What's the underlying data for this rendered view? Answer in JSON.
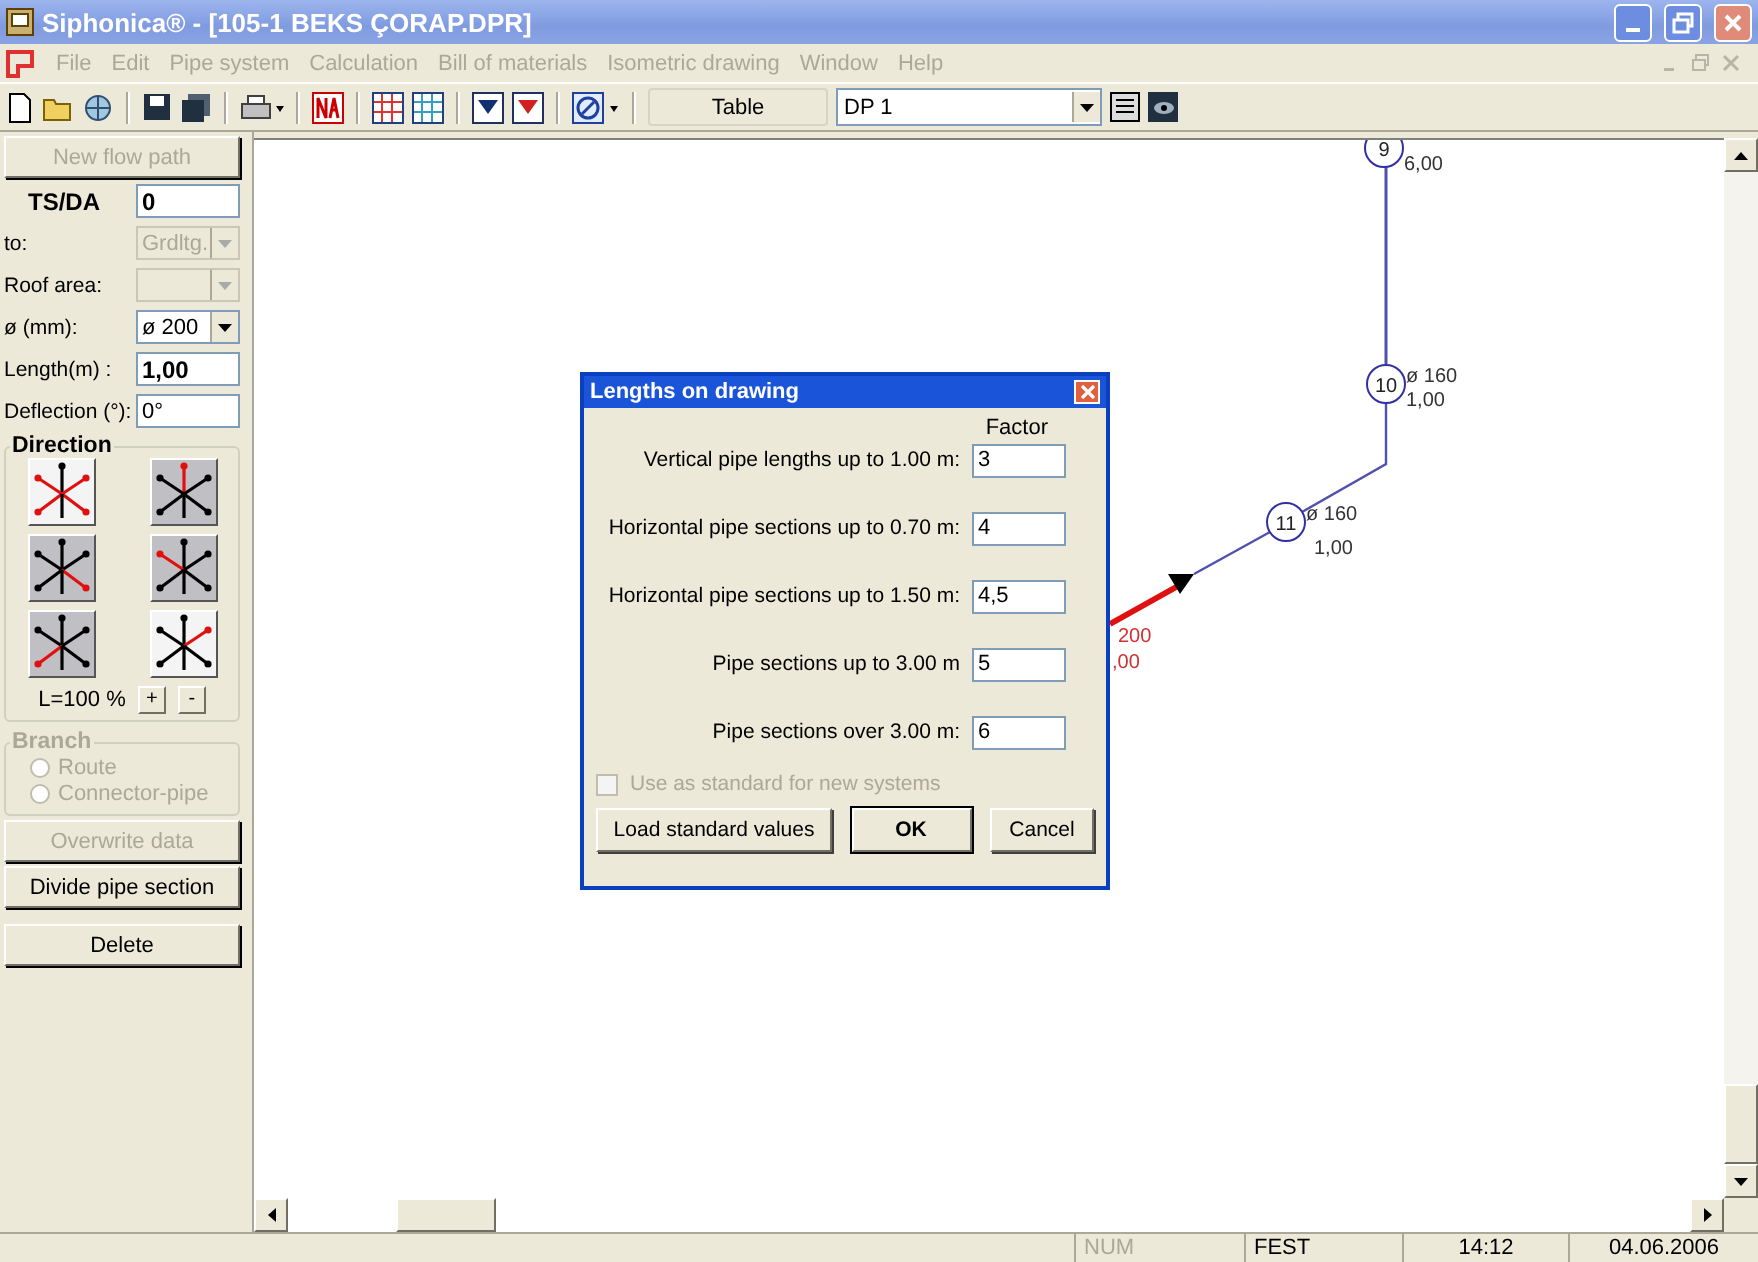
{
  "window": {
    "title": "Siphonica® - [105-1 BEKS ÇORAP.DPR]"
  },
  "menu": [
    {
      "label": "File",
      "disabled": true
    },
    {
      "label": "Edit",
      "disabled": true
    },
    {
      "label": "Pipe system",
      "disabled": true
    },
    {
      "label": "Calculation",
      "disabled": true
    },
    {
      "label": "Bill of materials",
      "disabled": true
    },
    {
      "label": "Isometric drawing",
      "disabled": true
    },
    {
      "label": "Window",
      "disabled": true
    },
    {
      "label": "Help",
      "disabled": true
    }
  ],
  "toolbar": {
    "table_button": "Table",
    "drawing_select": "DP 1"
  },
  "left_panel": {
    "new_flow_path": {
      "label": "New flow path",
      "disabled": true
    },
    "fields": [
      {
        "kind": "text",
        "label": "TS/DA",
        "value": "0"
      },
      {
        "kind": "select",
        "label": "to:",
        "value": "Grdltg.",
        "disabled": true
      },
      {
        "kind": "select",
        "label": "Roof area:",
        "disabled": true
      },
      {
        "kind": "select",
        "label": "ø (mm):",
        "value": "ø 200",
        "disabled": false
      },
      {
        "kind": "text",
        "label": "Length(m) :",
        "value": "1,00"
      },
      {
        "kind": "text",
        "label": "Deflection (°):",
        "value": "0°"
      }
    ],
    "direction": {
      "title": "Direction",
      "buttons": [
        {
          "kind": "diagonals"
        },
        {
          "kind": "up"
        },
        {
          "kind": "down-right"
        },
        {
          "kind": "up-left"
        },
        {
          "kind": "down-left"
        },
        {
          "kind": "up-right"
        }
      ],
      "scale": "L=100 %",
      "plus": "+",
      "minus": "-"
    },
    "branch": {
      "title": "Branch",
      "disabled": true,
      "options": [
        {
          "label": "Route",
          "selected": false
        },
        {
          "label": "Connector-pipe",
          "selected": false
        }
      ]
    },
    "buttons": [
      {
        "label": "Overwrite data",
        "disabled": true
      },
      {
        "label": "Divide pipe section",
        "disabled": false
      },
      {
        "label": "Delete",
        "disabled": false
      }
    ]
  },
  "drawing": {
    "nodes": [
      {
        "number": "9",
        "length": "6,00"
      },
      {
        "number": "10",
        "diameter": "ø 160",
        "length": "1,00"
      },
      {
        "number": "11",
        "diameter": "ø 160",
        "length": "1,00"
      }
    ],
    "selected_pipe": {
      "diameter": "200",
      "length": ",00"
    }
  },
  "dialog": {
    "title": "Lengths on drawing",
    "column_header": "Factor",
    "rows": [
      {
        "label": "Vertical pipe lengths up to 1.00 m:",
        "value": "3"
      },
      {
        "label": "Horizontal pipe sections up to 0.70 m:",
        "value": "4"
      },
      {
        "label": "Horizontal pipe sections up to 1.50 m:",
        "value": "4,5"
      },
      {
        "label": "Pipe sections up to 3.00 m",
        "value": "5"
      },
      {
        "label": "Pipe sections over 3.00 m:",
        "value": "6"
      }
    ],
    "checkbox": {
      "label": "Use as standard for new systems",
      "checked": false,
      "disabled": true
    },
    "buttons": [
      {
        "label": "Load standard values",
        "default": false
      },
      {
        "label": "OK",
        "default": true
      },
      {
        "label": "Cancel",
        "default": false
      }
    ]
  },
  "status_bar": [
    {
      "text": "NUM",
      "disabled": true
    },
    {
      "text": "FEST",
      "disabled": false
    },
    {
      "text": "14:12",
      "disabled": false
    },
    {
      "text": "04.06.2006",
      "disabled": false
    }
  ]
}
